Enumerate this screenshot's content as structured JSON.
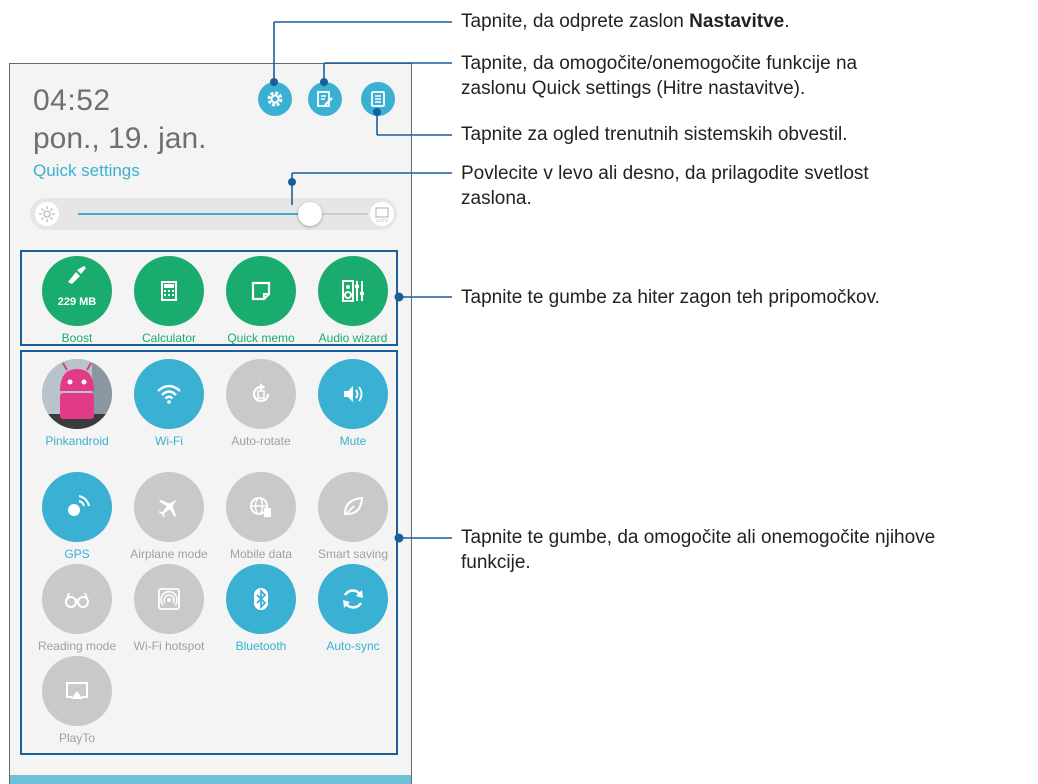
{
  "status": {
    "time": "04:52",
    "date": "pon., 19. jan.",
    "section_title": "Quick settings"
  },
  "header_buttons": [
    {
      "name": "settings",
      "icon": "gear-icon"
    },
    {
      "name": "edit",
      "icon": "edit-icon"
    },
    {
      "name": "notifications",
      "icon": "list-icon"
    }
  ],
  "brightness": {
    "level_percent": 80,
    "auto_label": "AUTO"
  },
  "apps": [
    {
      "label": "Boost",
      "badge": "229 MB",
      "icon": "rocket-broom-icon"
    },
    {
      "label": "Calculator",
      "icon": "calculator-icon"
    },
    {
      "label": "Quick memo",
      "icon": "memo-icon"
    },
    {
      "label": "Audio wizard",
      "icon": "equalizer-icon"
    }
  ],
  "toggles": [
    {
      "label": "Pinkandroid",
      "state": "avatar",
      "icon": "avatar"
    },
    {
      "label": "Wi-Fi",
      "state": "on",
      "icon": "wifi-icon"
    },
    {
      "label": "Auto-rotate",
      "state": "off",
      "icon": "rotate-icon"
    },
    {
      "label": "Mute",
      "state": "on",
      "icon": "speaker-icon"
    },
    {
      "label": "GPS",
      "state": "on",
      "icon": "gps-icon"
    },
    {
      "label": "Airplane mode",
      "state": "off",
      "icon": "airplane-icon"
    },
    {
      "label": "Mobile data",
      "state": "off",
      "icon": "globe-icon"
    },
    {
      "label": "Smart saving",
      "state": "off",
      "icon": "leaf-icon"
    },
    {
      "label": "Reading mode",
      "state": "off",
      "icon": "glasses-icon"
    },
    {
      "label": "Wi-Fi hotspot",
      "state": "off",
      "icon": "hotspot-icon"
    },
    {
      "label": "Bluetooth",
      "state": "on",
      "icon": "bluetooth-icon"
    },
    {
      "label": "Auto-sync",
      "state": "on",
      "icon": "sync-icon"
    },
    {
      "label": "PlayTo",
      "state": "off",
      "icon": "cast-icon"
    }
  ],
  "annotations": {
    "settings_pre": "Tapnite, da odprete zaslon ",
    "settings_bold": "Nastavitve",
    "settings_post": ".",
    "edit_line1": "Tapnite, da omogočite/onemogočite funkcije na",
    "edit_line2": "zaslonu Quick settings (Hitre nastavitve).",
    "notifications": "Tapnite za ogled trenutnih sistemskih obvestil.",
    "brightness_line1": "Povlecite v levo ali desno, da prilagodite svetlost",
    "brightness_line2": "zaslona.",
    "apps": "Tapnite te gumbe za hiter zagon teh pripomočkov.",
    "toggles_line1": "Tapnite te gumbe, da omogočite ali onemogočite njihove",
    "toggles_line2": "funkcije."
  },
  "colors": {
    "accent_blue": "#3ab0d2",
    "app_green": "#1aac6e",
    "off_gray": "#c9c9c9",
    "callout_line": "#1a5f9a"
  }
}
